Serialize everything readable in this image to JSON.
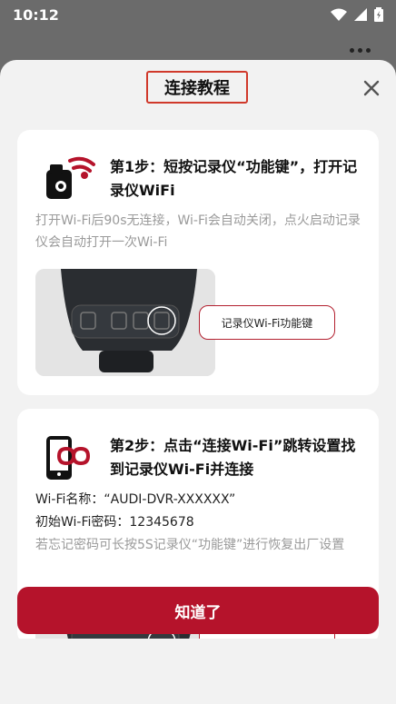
{
  "status_bar": {
    "time": "10:12"
  },
  "dialog": {
    "title": "连接教程",
    "step1": {
      "title": "第1步：短按记录仪“功能键”，打开记录仪WiFi",
      "desc": "打开Wi-Fi后90s无连接，Wi-Fi会自动关闭，点火启动记录仪会自动打开一次Wi-Fi",
      "callout": "记录仪Wi-Fi功能键"
    },
    "step2": {
      "title": "第2步：点击“连接Wi-Fi”跳转设置找到记录仪Wi-Fi并连接",
      "wifi_name": "Wi-Fi名称：“AUDI-DVR-XXXXXX”",
      "wifi_password": "初始Wi-Fi密码：12345678",
      "tip": "若忘记密码可长按5S记录仪“功能键”进行恢复出厂设置"
    },
    "confirm_label": "知道了"
  },
  "colors": {
    "accent": "#b5132b",
    "highlight_border": "#d0392b"
  }
}
